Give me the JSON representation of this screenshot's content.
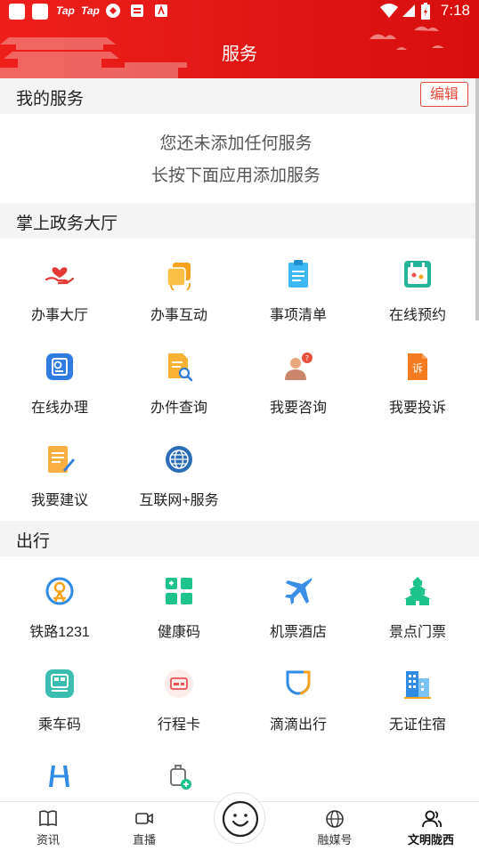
{
  "status_bar": {
    "time": "7:18",
    "tap1": "Tap",
    "tap2": "Tap"
  },
  "header": {
    "title": "服务"
  },
  "my_services": {
    "heading": "我的服务",
    "edit_label": "编辑",
    "empty_line1": "您还未添加任何服务",
    "empty_line2": "长按下面应用添加服务"
  },
  "hall": {
    "heading": "掌上政务大厅",
    "items": [
      {
        "label": "办事大厅",
        "icon": "hand-heart-icon"
      },
      {
        "label": "办事互动",
        "icon": "interaction-icon"
      },
      {
        "label": "事项清单",
        "icon": "clipboard-icon"
      },
      {
        "label": "在线预约",
        "icon": "calendar-icon"
      },
      {
        "label": "在线办理",
        "icon": "online-handle-icon"
      },
      {
        "label": "办件查询",
        "icon": "document-search-icon"
      },
      {
        "label": "我要咨询",
        "icon": "consult-icon"
      },
      {
        "label": "我要投诉",
        "icon": "complaint-icon"
      },
      {
        "label": "我要建议",
        "icon": "suggestion-icon"
      },
      {
        "label": "互联网+服务",
        "icon": "globe-icon"
      }
    ]
  },
  "travel": {
    "heading": "出行",
    "items": [
      {
        "label": "铁路1231",
        "icon": "railway-icon"
      },
      {
        "label": "健康码",
        "icon": "health-code-icon"
      },
      {
        "label": "机票酒店",
        "icon": "airplane-icon"
      },
      {
        "label": "景点门票",
        "icon": "temple-icon"
      },
      {
        "label": "乘车码",
        "icon": "bus-code-icon"
      },
      {
        "label": "行程卡",
        "icon": "trip-card-icon"
      },
      {
        "label": "滴滴出行",
        "icon": "didi-icon"
      },
      {
        "label": "无证住宿",
        "icon": "hotel-icon"
      }
    ]
  },
  "bottom_nav": {
    "items": [
      {
        "label": "资讯",
        "icon": "book-icon"
      },
      {
        "label": "直播",
        "icon": "video-icon"
      },
      {
        "label": "融媒号",
        "icon": "globe-outline-icon"
      },
      {
        "label": "文明陇西",
        "icon": "people-icon"
      }
    ]
  },
  "colors": {
    "brand_red": "#e31b17",
    "edit_red": "#e54b3a"
  }
}
